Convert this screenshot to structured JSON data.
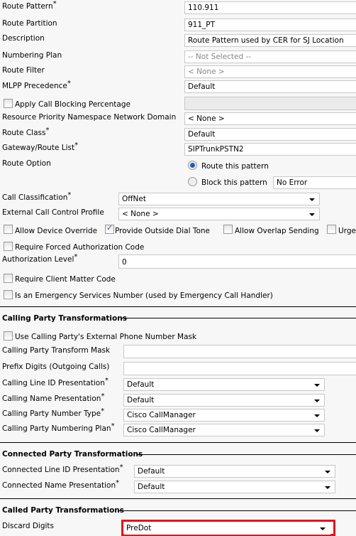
{
  "route": {
    "route_pattern": {
      "label": "Route Pattern",
      "value": "110.911"
    },
    "route_partition": {
      "label": "Route Partition",
      "value": "911_PT"
    },
    "description": {
      "label": "Description",
      "value": "Route Pattern used by CER for SJ Location"
    },
    "numbering_plan": {
      "label": "Numbering Plan",
      "value": "-- Not Selected --"
    },
    "route_filter": {
      "label": "Route Filter",
      "value": "< None >"
    },
    "mlpp": {
      "label": "MLPP Precedence",
      "value": "Default"
    },
    "call_blocking": {
      "label": "Apply Call Blocking Percentage",
      "checked": false
    },
    "resource_priority": {
      "label": "Resource Priority Namespace Network Domain",
      "value": "< None >"
    },
    "route_class": {
      "label": "Route Class",
      "value": "Default"
    },
    "gateway": {
      "label": "Gateway/Route List",
      "value": "SIPTrunkPSTN2"
    },
    "route_option": {
      "label": "Route Option",
      "route": "Route this pattern",
      "block": "Block this pattern",
      "block_reason": "No Error",
      "selected": "route"
    },
    "call_classification": {
      "label": "Call Classification",
      "value": "OffNet"
    },
    "external_profile": {
      "label": "External Call Control Profile",
      "value": "< None >"
    },
    "allow_device_override": {
      "label": "Allow Device Override",
      "checked": false
    },
    "outside_dial_tone": {
      "label": "Provide Outside Dial Tone",
      "checked": true
    },
    "overlap_sending": {
      "label": "Allow Overlap Sending",
      "checked": false
    },
    "urgent": {
      "label": "Urge",
      "checked": false
    },
    "forced_auth": {
      "label": "Require Forced Authorization Code",
      "checked": false
    },
    "auth_level": {
      "label": "Authorization Level",
      "value": "0"
    },
    "client_matter": {
      "label": "Require Client Matter Code",
      "checked": false
    },
    "emergency": {
      "label": "Is an Emergency Services Number (used by Emergency Call Handler)",
      "checked": false
    }
  },
  "calling": {
    "title": "Calling Party Transformations",
    "use_mask": {
      "label": "Use Calling Party's External Phone Number Mask",
      "checked": false
    },
    "transform_mask": {
      "label": "Calling Party Transform Mask",
      "value": ""
    },
    "prefix": {
      "label": "Prefix Digits (Outgoing Calls)",
      "value": ""
    },
    "clid": {
      "label": "Calling Line ID Presentation",
      "value": "Default"
    },
    "name": {
      "label": "Calling Name Presentation",
      "value": "Default"
    },
    "number_type": {
      "label": "Calling Party Number Type",
      "value": "Cisco CallManager"
    },
    "numbering_plan": {
      "label": "Calling Party Numbering Plan",
      "value": "Cisco CallManager"
    }
  },
  "connected": {
    "title": "Connected Party Transformations",
    "line_id": {
      "label": "Connected Line ID Presentation",
      "value": "Default"
    },
    "name": {
      "label": "Connected Name Presentation",
      "value": "Default"
    }
  },
  "called": {
    "title": "Called Party Transformations",
    "discard": {
      "label": "Discard Digits",
      "value": "PreDot"
    },
    "highlight_color": "#e0161e"
  }
}
